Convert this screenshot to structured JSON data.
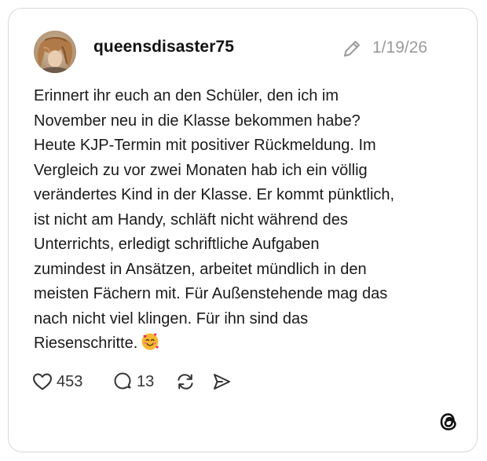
{
  "post": {
    "username": "queensdisaster75",
    "date": "1/19/26",
    "text_lines": [
      "Erinnert ihr euch an den Schüler, den ich im",
      "November neu in die Klasse bekommen habe?",
      "Heute KJP-Termin mit positiver Rückmeldung. Im",
      "Vergleich zu vor zwei Monaten hab ich ein völlig",
      "verändertes Kind in der Klasse. Er kommt pünktlich,",
      "ist nicht am Handy, schläft nicht während des",
      "Unterrichts, erledigt schriftliche Aufgaben",
      "zumindest in Ansätzen, arbeitet mündlich in den",
      "meisten Fächern mit. Für Außenstehende mag das",
      "nach nicht viel klingen. Für ihn sind das",
      "Riesenschritte."
    ],
    "emoji": "smiling-face-with-hearts"
  },
  "actions": {
    "likes": "453",
    "comments": "13"
  },
  "icons": {
    "like": "heart-icon",
    "comment": "comment-icon",
    "repost": "repost-icon",
    "share": "send-icon",
    "edit": "pencil-icon",
    "brand": "threads-logo-icon"
  },
  "colors": {
    "text": "#1a1a1a",
    "muted": "#9a9a9a",
    "border": "#d9d9d9",
    "emoji": "#f5a623"
  }
}
